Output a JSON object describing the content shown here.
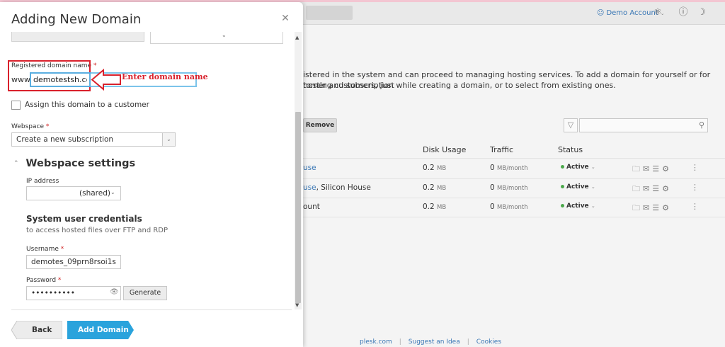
{
  "modal": {
    "title": "Adding New Domain",
    "registered_label": "Registered domain name",
    "required_mark": "*",
    "www_prefix": "www.",
    "domain_value": "demotestsh.com",
    "annotation": "Enter domain name",
    "assign_label": "Assign this domain to a customer",
    "webspace_label": "Webspace",
    "webspace_value": "Create a new subscription",
    "webspace_settings_title": "Webspace settings",
    "ip_label": "IP address",
    "ip_value": "(shared)",
    "creds_title": "System user credentials",
    "creds_subtitle": "to access hosted files over FTP and RDP",
    "username_label": "Username",
    "username_value": "demotes_09prn8rsoi1s",
    "password_label": "Password",
    "password_value": "••••••••••",
    "generate_label": "Generate",
    "back_label": "Back",
    "add_label": "Add Domain"
  },
  "background": {
    "account_label": "Demo Account",
    "intro_line1": "istered in the system and can proceed to managing hosting services. To add a domain for yourself or for hosting customers, just",
    "intro_line2": "tomer and subscription while creating a domain, or to select from existing ones.",
    "remove_label": "Remove",
    "col_disk": "Disk Usage",
    "col_traffic": "Traffic",
    "col_status": "Status",
    "rows": [
      {
        "name": "use",
        "suffix": "",
        "disk_value": "0.2",
        "disk_unit": "MB",
        "traffic_value": "0",
        "traffic_unit": "MB/month",
        "status": "Active"
      },
      {
        "name": "use",
        "suffix": ", Silicon House",
        "disk_value": "0.2",
        "disk_unit": "MB",
        "traffic_value": "0",
        "traffic_unit": "MB/month",
        "status": "Active"
      },
      {
        "name": "ount",
        "suffix": "",
        "disk_value": "0.2",
        "disk_unit": "MB",
        "traffic_value": "0",
        "traffic_unit": "MB/month",
        "status": "Active"
      }
    ],
    "footer": [
      "plesk.com",
      "Suggest an Idea",
      "Cookies"
    ]
  },
  "colors": {
    "accent_blue": "#2aa3dc",
    "highlight_red": "#d9212c",
    "link_blue": "#3a77b5"
  }
}
